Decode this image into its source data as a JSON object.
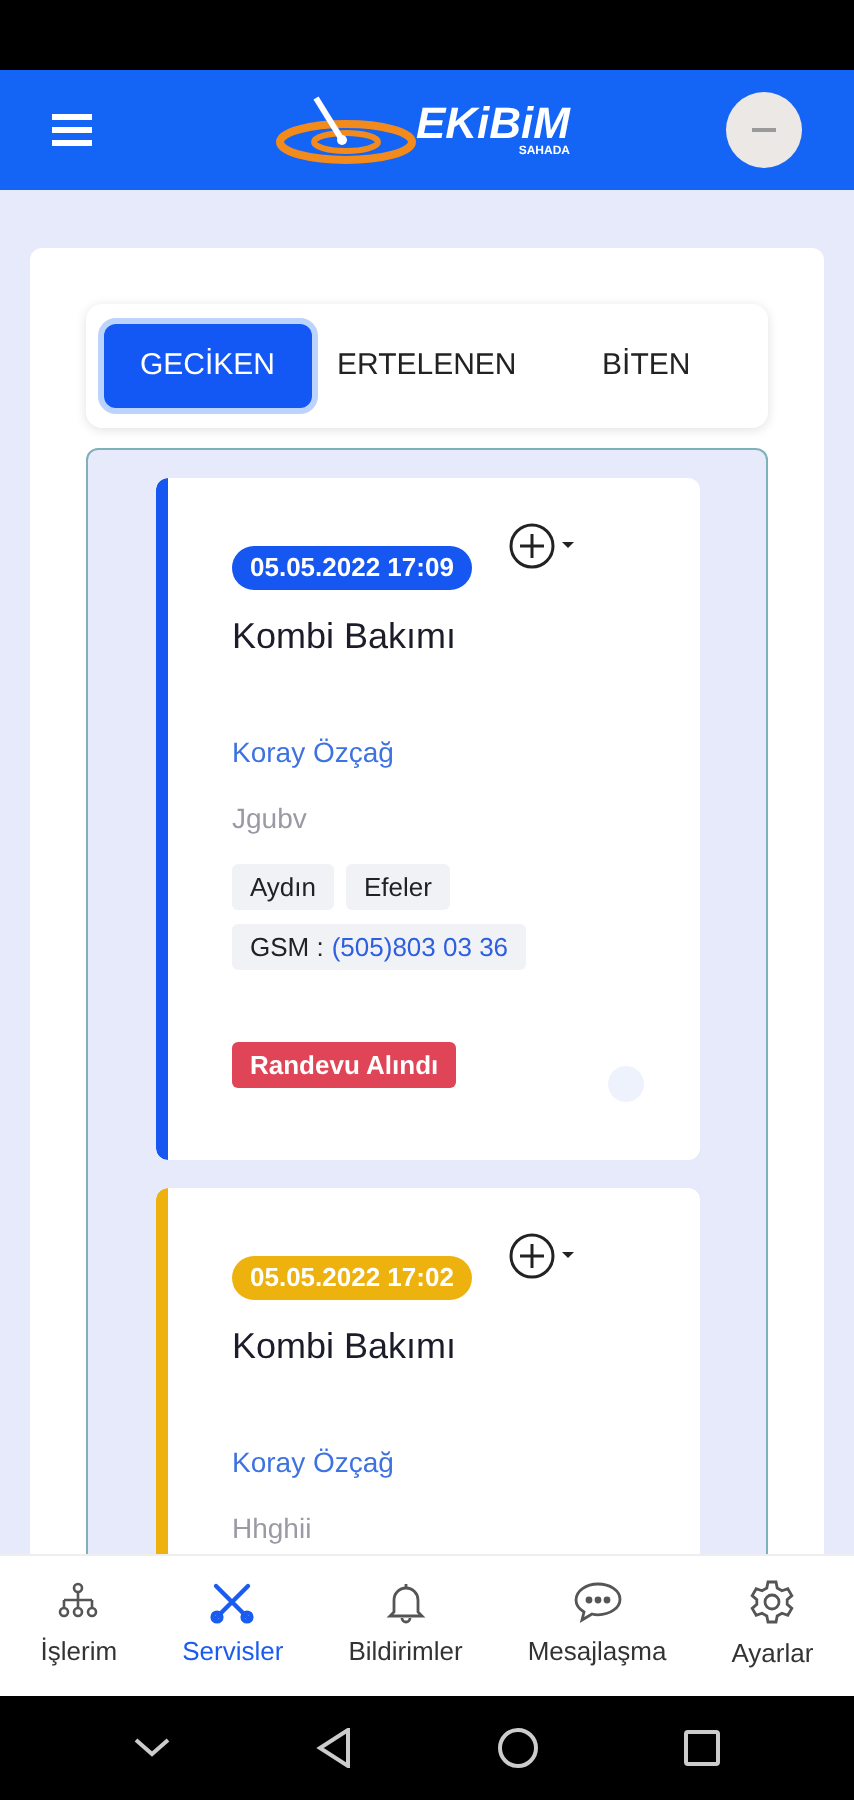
{
  "header": {
    "logo_text": "EKiBiM",
    "logo_subtext": "SAHADA"
  },
  "tabs": [
    {
      "label": "GECİKEN",
      "selected": true
    },
    {
      "label": "ERTELENEN",
      "selected": false
    },
    {
      "label": "BİTEN",
      "selected": false
    }
  ],
  "cards": [
    {
      "color": "#1557f0",
      "datetime": "05.05.2022 17:09",
      "title": "Kombi Bakımı",
      "customer": "Koray Özçağ",
      "note": "Jgubv",
      "tags": [
        "Aydın",
        "Efeler"
      ],
      "gsm_label": "GSM :",
      "gsm": "(505)803 03 36",
      "status": "Randevu Alındı"
    },
    {
      "color": "#eeb20f",
      "datetime": "05.05.2022 17:02",
      "title": "Kombi Bakımı",
      "customer": "Koray Özçağ",
      "note": "Hhghii"
    }
  ],
  "bottom_nav": [
    {
      "kind": "org",
      "label": "İşlerim",
      "selected": false
    },
    {
      "kind": "tools",
      "label": "Servisler",
      "selected": true
    },
    {
      "kind": "bell",
      "label": "Bildirimler",
      "selected": false
    },
    {
      "kind": "chat",
      "label": "Mesajlaşma",
      "selected": false
    },
    {
      "kind": "gear",
      "label": "Ayarlar",
      "selected": false
    }
  ]
}
